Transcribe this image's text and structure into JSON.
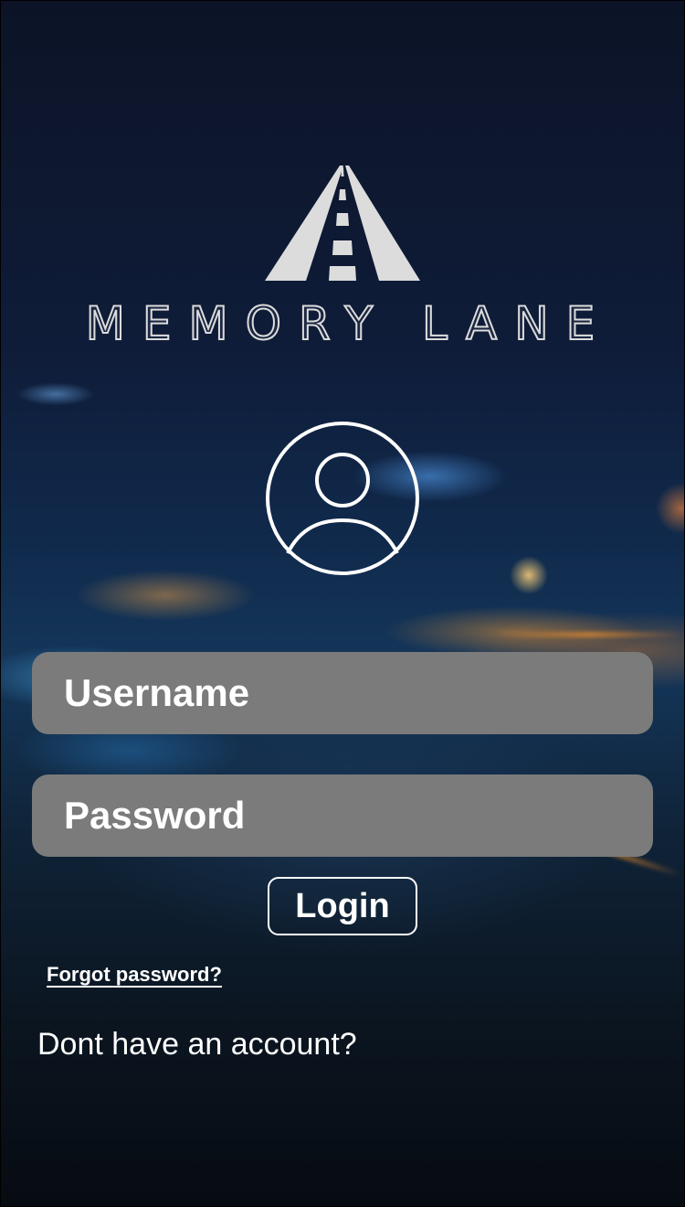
{
  "brand": {
    "name": "MEMORY LANE",
    "logo_icon": "road-icon"
  },
  "avatar": {
    "icon": "user-circle-icon"
  },
  "form": {
    "username_placeholder": "Username",
    "password_placeholder": "Password",
    "login_label": "Login",
    "forgot_label": "Forgot password?",
    "signup_prompt": "Dont have an account?"
  },
  "colors": {
    "field_bg": "#7b7b7b",
    "text": "#ffffff",
    "logo": "#dcdcdc"
  }
}
